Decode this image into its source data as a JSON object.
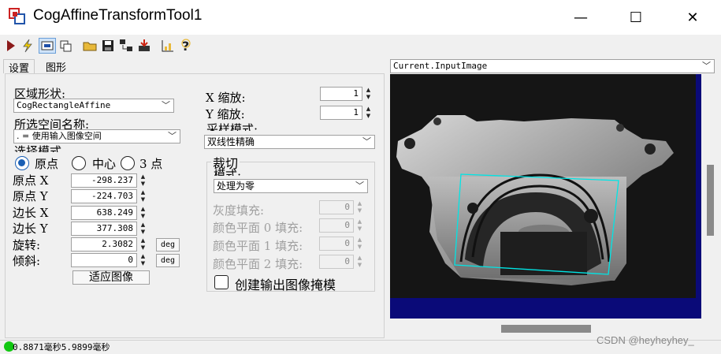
{
  "window": {
    "title": "CogAffineTransformTool1",
    "minimize_glyph": "—",
    "maximize_glyph": "☐",
    "close_glyph": "✕"
  },
  "toolbar": {
    "icons": [
      "run-icon",
      "lightning-icon",
      "display-icon",
      "copy-icon",
      "open-folder-icon",
      "save-icon",
      "network-icon",
      "import-icon",
      "chart-icon",
      "help-icon"
    ]
  },
  "tabs": [
    {
      "label": "设置"
    },
    {
      "label": "图形"
    }
  ],
  "settings": {
    "region_shape_label": "区域形状:",
    "region_shape_value": "CogRectangleAffine",
    "space_name_label": "所选空间名称:",
    "space_name_value": ". = 使用输入图像空间",
    "selection_mode_label": "选择模式",
    "radio_origin": "原点",
    "radio_center": "中心",
    "radio_three_point": "3 点",
    "origin_x_label": "原点 X",
    "origin_x_value": "-298.237",
    "origin_y_label": "原点 Y",
    "origin_y_value": "-224.703",
    "side_x_label": "边长 X",
    "side_x_value": "638.249",
    "side_y_label": "边长 Y",
    "side_y_value": "377.308",
    "rotation_label": "旋转:",
    "rotation_value": "2.3082",
    "skew_label": "倾斜:",
    "skew_value": "0",
    "deg_label": "deg",
    "fit_image_label": "适应图像",
    "x_scale_label": "X 缩放:",
    "x_scale_value": "1",
    "y_scale_label": "Y 缩放:",
    "y_scale_value": "1",
    "sampling_mode_label": "采样模式:",
    "sampling_mode_value": "双线性精确",
    "clip_group_label": "裁切",
    "clip_mode_label": "模式:",
    "clip_mode_value": "处理为零",
    "gray_fill_label": "灰度填充:",
    "gray_fill_value": "0",
    "plane0_label": "颜色平面 0 填充:",
    "plane0_value": "0",
    "plane1_label": "颜色平面 1 填充:",
    "plane1_value": "0",
    "plane2_label": "颜色平面 2 填充:",
    "plane2_value": "0",
    "create_mask_label": "创建输出图像掩模"
  },
  "image_panel": {
    "selected_image": "Current.InputImage",
    "region_color": "#00e5e5",
    "background_color": "#0a0a78"
  },
  "status": {
    "text": "0.8871毫秒5.9899毫秒",
    "indicator_color": "#11c711"
  },
  "watermark": "CSDN @heyheyhey_"
}
